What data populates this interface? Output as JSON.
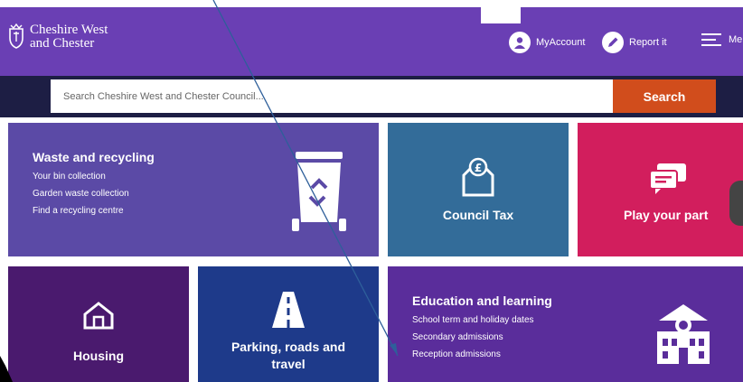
{
  "header": {
    "logo_line1": "Cheshire West",
    "logo_line2": "and Chester",
    "my_account_label": "MyAccount",
    "report_label": "Report it",
    "menu_label": "Me",
    "background": "#6a3fb4"
  },
  "search": {
    "placeholder": "Search Cheshire West and Chester Council...",
    "button_label": "Search",
    "bar_color": "#1d1e44",
    "button_color": "#d14d1c"
  },
  "tiles": {
    "waste": {
      "title": "Waste and recycling",
      "links": [
        "Your bin collection",
        "Garden waste collection",
        "Find a recycling centre"
      ],
      "icon": "wheelie-bin-icon",
      "color": "#5b4aa6"
    },
    "council_tax": {
      "title": "Council Tax",
      "icon": "house-pound-icon",
      "color": "#336c99"
    },
    "play": {
      "title": "Play your part",
      "icon": "chat-bubble-icon",
      "color": "#d21e5d"
    },
    "housing": {
      "title": "Housing",
      "icon": "house-icon",
      "color": "#4a1a6e"
    },
    "parking": {
      "title_line1": "Parking, roads and",
      "title_line2": "travel",
      "icon": "road-icon",
      "color": "#1e3a8a"
    },
    "education": {
      "title": "Education and learning",
      "links": [
        "School term and holiday dates",
        "Secondary admissions",
        "Reception admissions"
      ],
      "icon": "school-building-icon",
      "color": "#5a2d9b"
    }
  }
}
